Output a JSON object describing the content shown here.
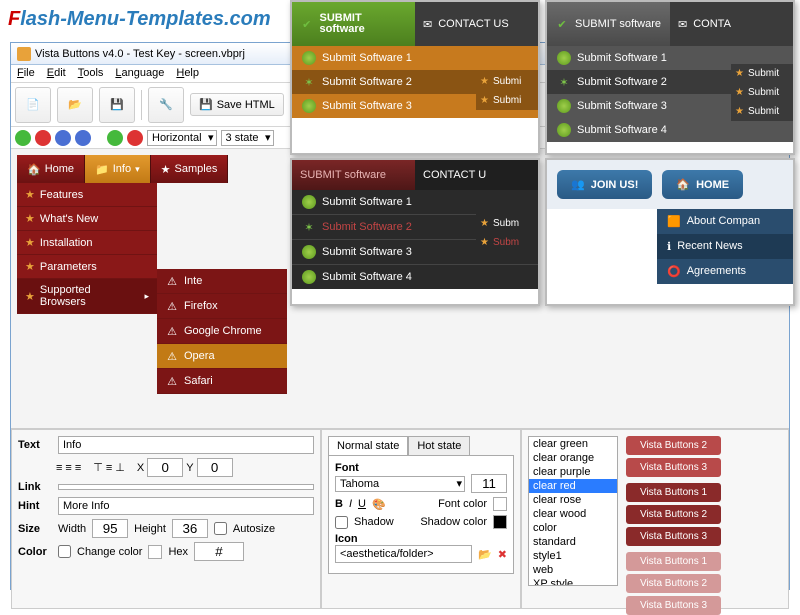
{
  "logo": {
    "brand_f": "F",
    "brand_rest": "lash-Menu-Templates.com"
  },
  "window": {
    "title": "Vista Buttons v4.0 - Test Key - screen.vbprj",
    "menus": [
      "File",
      "Edit",
      "Tools",
      "Language",
      "Help"
    ],
    "save_html": "Save HTML",
    "orientation": "Horizontal",
    "states": "3 state"
  },
  "red_menu": {
    "tabs": [
      {
        "label": "Home"
      },
      {
        "label": "Info"
      },
      {
        "label": "Samples"
      }
    ],
    "dropdown": [
      "Features",
      "What's New",
      "Installation",
      "Parameters",
      "Supported Browsers"
    ],
    "submenu_title_icon": "⚠",
    "submenu": [
      "Internet Explorer",
      "Firefox",
      "Google Chrome",
      "Opera",
      "Safari"
    ],
    "submenu_short": [
      "Inte",
      "Firefox",
      "Google Chrome",
      "Opera",
      "Safari"
    ]
  },
  "ov1": {
    "head": [
      {
        "label": "SUBMIT software"
      },
      {
        "label": "CONTACT US"
      }
    ],
    "items": [
      "Submit Software 1",
      "Submit Software 2",
      "Submit Software 3"
    ],
    "sub": [
      "Submi",
      "Submi"
    ]
  },
  "ov2": {
    "head": [
      {
        "label": "SUBMIT software"
      },
      {
        "label": "CONTA"
      }
    ],
    "items": [
      "Submit Software 1",
      "Submit Software 2",
      "Submit Software 3",
      "Submit Software 4"
    ],
    "sub": [
      "Submit",
      "Submit",
      "Submit"
    ]
  },
  "ov3": {
    "head": [
      {
        "label": "SUBMIT software"
      },
      {
        "label": "CONTACT U"
      }
    ],
    "items": [
      "Submit Software 1",
      "Submit Software 2",
      "Submit Software 3",
      "Submit Software 4"
    ],
    "sub": [
      "Subm",
      "Subm"
    ]
  },
  "ov4": {
    "join": "JOIN US!",
    "home": "HOME",
    "items": [
      "About Compan",
      "Recent News",
      "Agreements"
    ]
  },
  "props": {
    "text_label": "Text",
    "text_value": "Info",
    "x_label": "X",
    "x_value": "0",
    "y_label": "Y",
    "y_value": "0",
    "link_label": "Link",
    "hint_label": "Hint",
    "hint_value": "More Info",
    "size_label": "Size",
    "width_label": "Width",
    "width_value": "95",
    "height_label": "Height",
    "height_value": "36",
    "autosize": "Autosize",
    "color_label": "Color",
    "change_color": "Change color",
    "hex_label": "Hex",
    "hex_value": "#"
  },
  "state_panel": {
    "tabs": [
      "Normal state",
      "Hot state"
    ],
    "font_label": "Font",
    "font_value": "Tahoma",
    "font_size": "11",
    "b": "B",
    "i": "I",
    "u": "U",
    "fontcolor_label": "Font color",
    "shadow": "Shadow",
    "shadowcolor_label": "Shadow color",
    "icon_label": "Icon",
    "icon_value": "<aesthetica/folder>"
  },
  "styles": {
    "list": [
      "clear green",
      "clear orange",
      "clear purple",
      "clear red",
      "clear rose",
      "clear wood",
      "color",
      "standard",
      "style1",
      "web",
      "XP style"
    ],
    "selected": "clear red"
  },
  "previews": {
    "set_a": [
      "Vista Buttons 2",
      "Vista Buttons 3"
    ],
    "set_b": [
      "Vista Buttons 1",
      "Vista Buttons 2",
      "Vista Buttons 3"
    ],
    "set_c": [
      "Vista Buttons 1",
      "Vista Buttons 2",
      "Vista Buttons 3"
    ]
  }
}
